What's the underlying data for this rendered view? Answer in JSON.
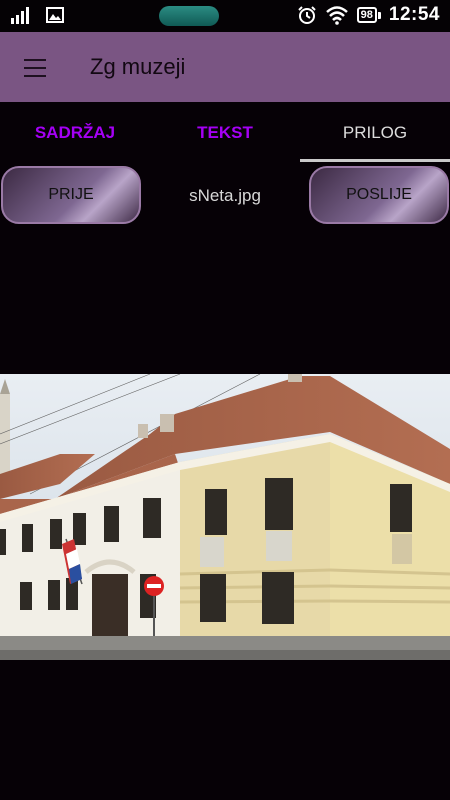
{
  "status_bar": {
    "icons": [
      "signal-icon",
      "image-icon",
      "alarm-icon",
      "wifi-icon"
    ],
    "battery": "98",
    "time": "12:54"
  },
  "toolbar": {
    "menu_icon": "menu-icon",
    "title": "Zg muzeji"
  },
  "tabs": [
    {
      "label": "SADRŽAJ",
      "active": false
    },
    {
      "label": "TEKST",
      "active": false
    },
    {
      "label": "PRILOG",
      "active": true
    }
  ],
  "attachment": {
    "prev_label": "PRIJE",
    "next_label": "POSLIJE",
    "file_name": "sNeta.jpg"
  },
  "colors": {
    "toolbar": "#7a5583",
    "background": "#060106",
    "tab_accent": "#a500f5"
  }
}
